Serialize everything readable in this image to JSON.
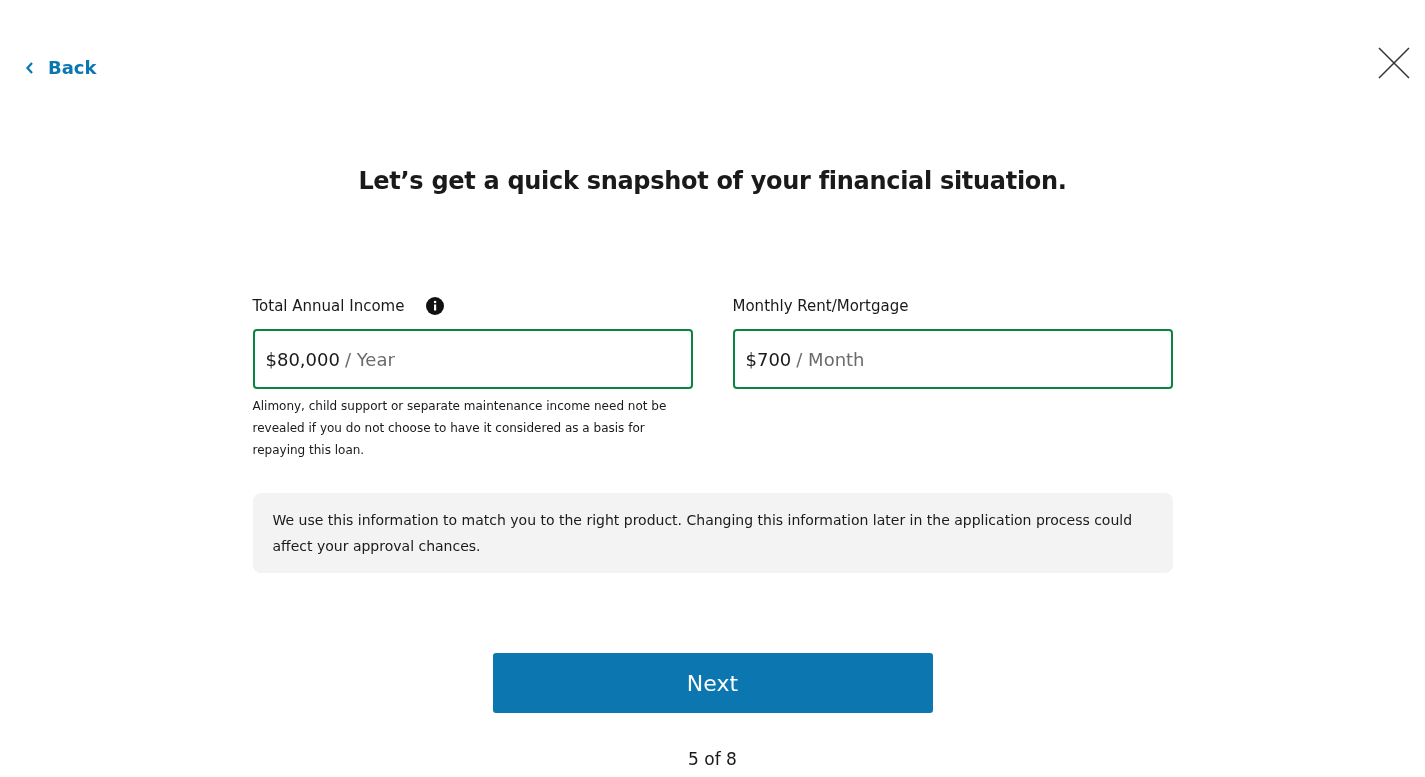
{
  "back_link": "Back",
  "heading": "Let’s get a quick snapshot of your financial situation.",
  "fields": [
    {
      "label": "Total Annual Income",
      "info": true,
      "value": "$80,000",
      "suffix": "/ Year",
      "valid": true,
      "help": "Alimony, child support or separate maintenance income need not be revealed if you do not choose to have it considered as a basis for repaying this loan."
    },
    {
      "label": "Monthly Rent/Mortgage",
      "info": false,
      "value": "$700",
      "suffix": "/ Month",
      "valid": true
    }
  ],
  "notice": "We use this information to match you to the right product. Changing this information later in the application process could affect your approval chances.",
  "next_button": "Next",
  "progress": "5 of 8"
}
